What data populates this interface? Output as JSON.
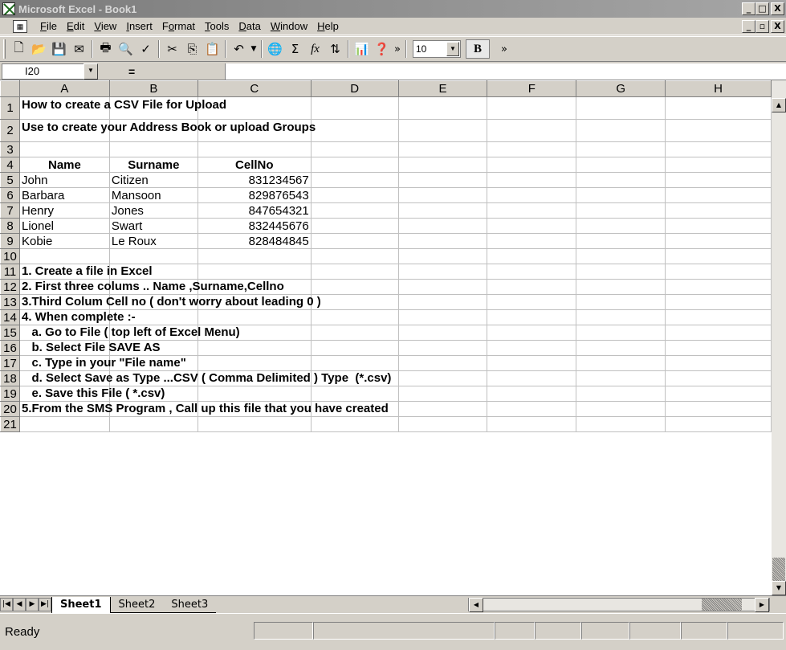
{
  "window": {
    "title": "Microsoft Excel - Book1"
  },
  "title_buttons": [
    "_",
    "□",
    "X"
  ],
  "doc_buttons": [
    "_",
    "▫",
    "X"
  ],
  "menu": [
    {
      "label": "File",
      "key": "F",
      "rest": "ile"
    },
    {
      "label": "Edit",
      "key": "E",
      "rest": "dit"
    },
    {
      "label": "View",
      "key": "V",
      "rest": "iew"
    },
    {
      "label": "Insert",
      "key": "I",
      "rest": "nsert"
    },
    {
      "label": "Format",
      "pre": "F",
      "key": "o",
      "rest": "rmat"
    },
    {
      "label": "Tools",
      "key": "T",
      "rest": "ools"
    },
    {
      "label": "Data",
      "key": "D",
      "rest": "ata"
    },
    {
      "label": "Window",
      "key": "W",
      "rest": "indow"
    },
    {
      "label": "Help",
      "key": "H",
      "rest": "elp"
    }
  ],
  "toolbar": {
    "font_size": "10",
    "bold": "B",
    "more": "»"
  },
  "formula_bar": {
    "name_box": "I20",
    "equals": "=",
    "formula": ""
  },
  "columns": [
    "A",
    "B",
    "C",
    "D",
    "E",
    "F",
    "G",
    "H"
  ],
  "rows": {
    "r1": "How to create a CSV File for Upload",
    "r2": "Use to create your Address Book or upload Groups",
    "header": [
      "Name",
      "Surname",
      "CellNo"
    ],
    "data": [
      [
        "John",
        "Citizen",
        "831234567"
      ],
      [
        "Barbara",
        "Mansoon",
        "829876543"
      ],
      [
        "Henry",
        "Jones",
        "847654321"
      ],
      [
        "Lionel",
        "Swart",
        "832445676"
      ],
      [
        "Kobie",
        "Le Roux",
        "828484845"
      ]
    ],
    "r11": "1. Create a file in Excel",
    "r12": "2. First three colums .. Name ,Surname,Cellno",
    "r13": "3.Third Colum Cell no ( don't worry about leading 0 )",
    "r14": "4. When complete :-",
    "r15": "   a. Go to File ( top left of Excel Menu)",
    "r16": "   b. Select File SAVE AS",
    "r17": "   c. Type in your \"File name\"",
    "r18": "   d. Select Save as Type ...CSV ( Comma Delimited ) Type  (*.csv)",
    "r19": "   e. Save this File ( *.csv)",
    "r20": "5.From the SMS Program , Call up this file that you have created"
  },
  "row_numbers": [
    "1",
    "2",
    "3",
    "4",
    "5",
    "6",
    "7",
    "8",
    "9",
    "10",
    "11",
    "12",
    "13",
    "14",
    "15",
    "16",
    "17",
    "18",
    "19",
    "20",
    "21"
  ],
  "sheets": [
    "Sheet1",
    "Sheet2",
    "Sheet3"
  ],
  "status": "Ready"
}
